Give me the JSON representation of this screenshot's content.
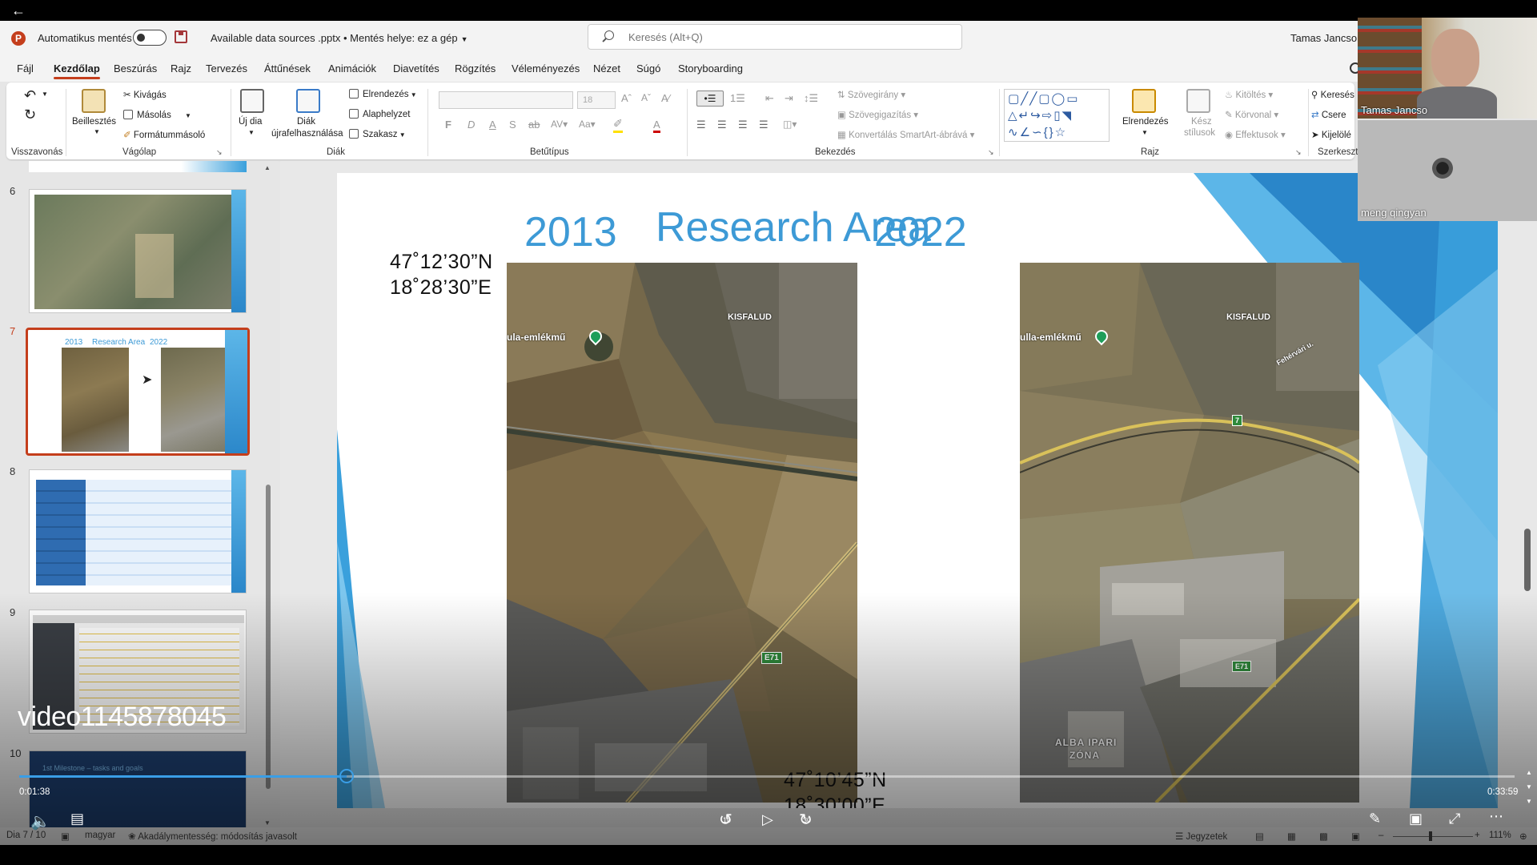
{
  "window": {
    "back_icon": "arrow-left-icon"
  },
  "titlebar": {
    "app_logo": "P",
    "autosave_label": "Automatikus mentés",
    "doc_title": "Available data sources .pptx • Mentés helye: ez a gép",
    "search_placeholder": "Keresés (Alt+Q)",
    "user_name": "Tamas Jancso"
  },
  "menu": {
    "tabs": [
      {
        "label": "Fájl"
      },
      {
        "label": "Kezdőlap",
        "active": true
      },
      {
        "label": "Beszúrás"
      },
      {
        "label": "Rajz"
      },
      {
        "label": "Tervezés"
      },
      {
        "label": "Áttűnések"
      },
      {
        "label": "Animációk"
      },
      {
        "label": "Diavetítés"
      },
      {
        "label": "Rögzítés"
      },
      {
        "label": "Véleményezés"
      },
      {
        "label": "Nézet"
      },
      {
        "label": "Súgó"
      },
      {
        "label": "Storyboarding"
      }
    ]
  },
  "ribbon": {
    "groups": {
      "undo": "Visszavonás",
      "clipboard": "Vágólap",
      "slides": "Diák",
      "font": "Betűtípus",
      "paragraph": "Bekezdés",
      "drawing": "Rajz",
      "editing": "Szerkeszt"
    },
    "clipboard": {
      "paste": "Beillesztés",
      "cut": "Kivágás",
      "copy": "Másolás",
      "format_painter": "Formátummásoló"
    },
    "slides": {
      "new_slide": "Új dia",
      "reuse": "Diák",
      "reuse2": "újrafelhasználása",
      "layout": "Elrendezés",
      "reset": "Alaphelyzet",
      "section": "Szakasz"
    },
    "font": {
      "size": "18"
    },
    "paragraph": {
      "text_direction": "Szövegirány",
      "align_text": "Szövegigazítás",
      "smartart": "Konvertálás SmartArt-ábrává"
    },
    "drawing": {
      "arrange": "Elrendezés",
      "quick_styles": "Kész",
      "quick_styles2": "stílusok",
      "fill": "Kitöltés",
      "outline": "Körvonal",
      "effects": "Effektusok"
    },
    "editing": {
      "find": "Keresés",
      "replace": "Csere",
      "select": "Kijelölé"
    }
  },
  "thumbnails": [
    {
      "num": "6"
    },
    {
      "num": "7",
      "selected": true,
      "year_left": "2013",
      "title": "Research Area",
      "year_right": "2022"
    },
    {
      "num": "8"
    },
    {
      "num": "9"
    },
    {
      "num": "10",
      "title": "1st Milestone – tasks and goals"
    }
  ],
  "slide": {
    "year_left": "2013",
    "title": "Research Area",
    "year_right": "2022",
    "coord_top_lat": "47˚12’30”N",
    "coord_top_lon": "18˚28’30”E",
    "coord_bot_lat": "47˚10’45”N",
    "coord_bot_lon": "18˚30’00”E",
    "map_left": {
      "kisfalud": "KISFALUD",
      "memorial": "ula-emlékmű",
      "highway": "E71"
    },
    "map_right": {
      "kisfalud": "KISFALUD",
      "memorial": "ulla-emlékmű",
      "road": "Fehérvári u.",
      "highway": "E71",
      "route": "7",
      "zone1": "ALBA IPARI",
      "zone2": "ZÓNA"
    }
  },
  "video": {
    "name": "video1145878045",
    "time_current": "0:01:38",
    "time_total": "0:33:59",
    "progress": 0.219,
    "rewind_label": "10",
    "forward_label": "30"
  },
  "statusbar": {
    "slide_counter": "Dia 7 / 10",
    "language": "magyar",
    "accessibility": "Akadálymentesség: módosítás javasolt",
    "notes": "Jegyzetek",
    "zoom": "111%"
  },
  "participants": [
    {
      "name": "Tamas Jancso"
    },
    {
      "name": "meng qingyan"
    }
  ]
}
